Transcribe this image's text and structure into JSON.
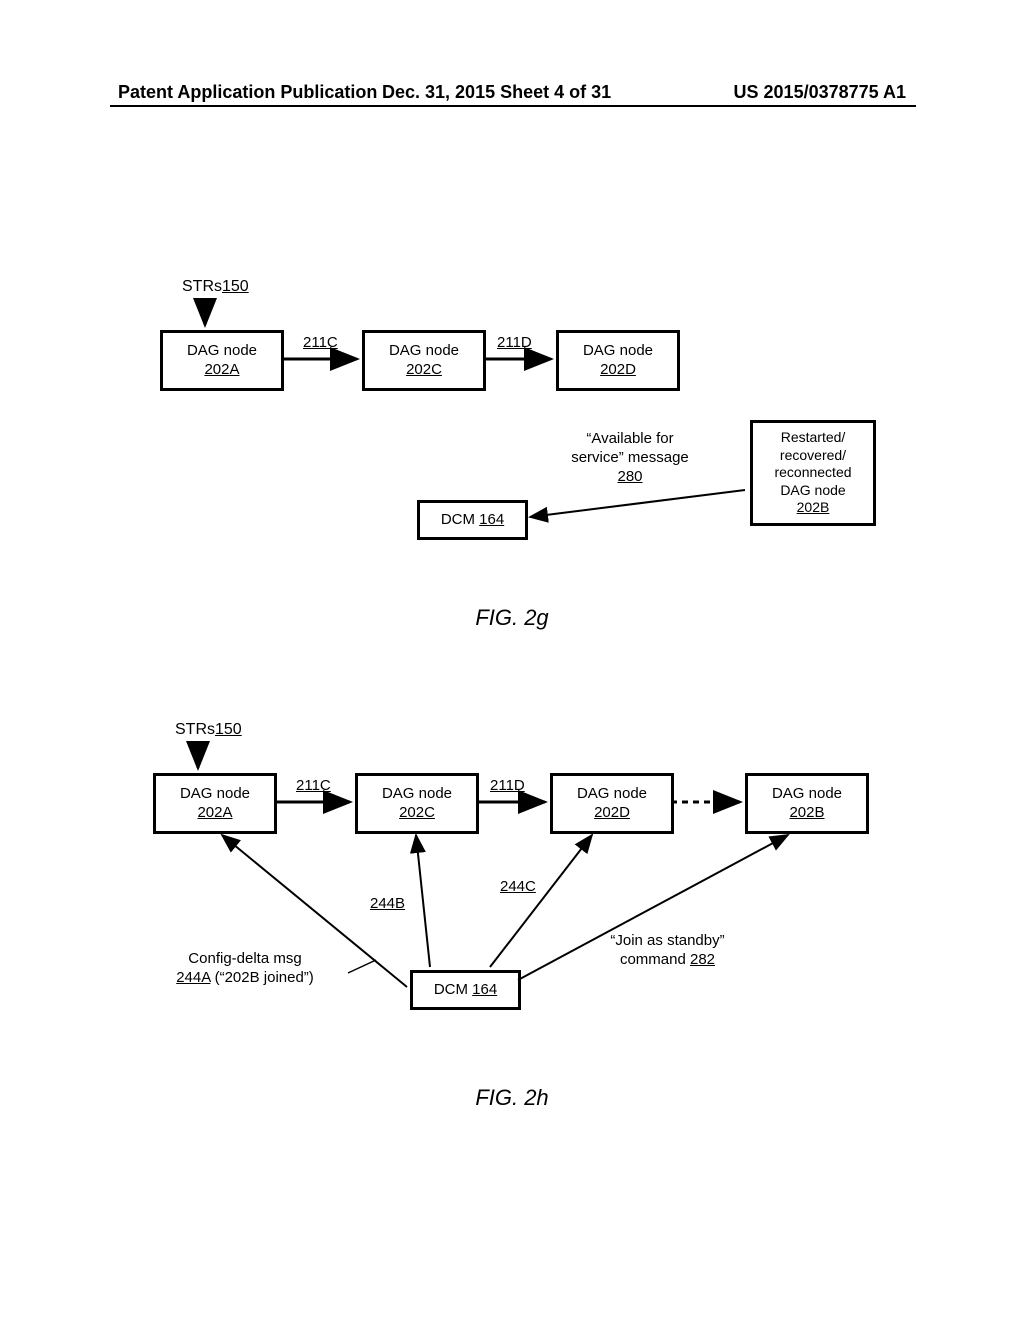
{
  "header": {
    "left": "Patent Application Publication",
    "center": "Dec. 31, 2015  Sheet 4 of 31",
    "right": "US 2015/0378775 A1"
  },
  "fig2g": {
    "strs_label": "STRs",
    "strs_ref": "150",
    "node_a_text": "DAG node",
    "node_a_ref": "202A",
    "node_c_text": "DAG node",
    "node_c_ref": "202C",
    "node_d_text": "DAG node",
    "node_d_ref": "202D",
    "arrow_ac": "211C",
    "arrow_cd": "211D",
    "available_line1": "“Available for",
    "available_line2": "service” message",
    "available_ref": "280",
    "recovered_line1": "Restarted/",
    "recovered_line2": "recovered/",
    "recovered_line3": "reconnected",
    "recovered_line4": "DAG node",
    "recovered_ref": "202B",
    "dcm_text": "DCM",
    "dcm_ref": "164",
    "caption": "FIG. 2g"
  },
  "fig2h": {
    "strs_label": "STRs",
    "strs_ref": "150",
    "node_a_text": "DAG node",
    "node_a_ref": "202A",
    "node_c_text": "DAG node",
    "node_c_ref": "202C",
    "node_d_text": "DAG node",
    "node_d_ref": "202D",
    "node_b_text": "DAG node",
    "node_b_ref": "202B",
    "arrow_ac": "211C",
    "arrow_cd": "211D",
    "dcm_text": "DCM",
    "dcm_ref": "164",
    "arrow_244b": "244B",
    "arrow_244c": "244C",
    "config_line1": "Config-delta msg",
    "config_ref": "244A",
    "config_paren": " (“202B joined”)",
    "join_line1": "“Join as standby”",
    "join_line2": "command ",
    "join_ref": "282",
    "caption": "FIG. 2h"
  }
}
